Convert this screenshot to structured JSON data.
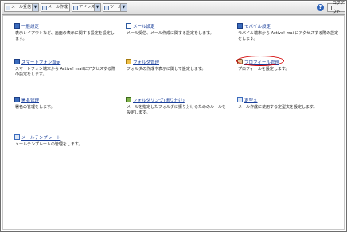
{
  "toolbar": {
    "buttons": [
      {
        "label": "メール受信",
        "icon": "mail-receive-icon"
      },
      {
        "label": "メール作成",
        "icon": "mail-compose-icon"
      },
      {
        "label": "アドレス帳",
        "icon": "address-book-icon"
      },
      {
        "label": "ツール",
        "icon": "tools-icon"
      }
    ],
    "help": "?",
    "logout": "ログアウト"
  },
  "items": [
    {
      "title": "一般設定",
      "desc": "表示レイアウトなど、画面の表示に関する設定を設定します。",
      "icon": "settings-icon"
    },
    {
      "title": "メール設定",
      "desc": "メール受信、メール作成に関する設定をします。",
      "icon": "mail-settings-icon"
    },
    {
      "title": "モバイル設定",
      "desc": "モバイル端末から Active! mailにアクセスする際の設定をします。",
      "icon": "mobile-icon"
    },
    {
      "title": "スマートフォン設定",
      "desc": "スマートフォン端末から Active! mailにアクセスする際の設定をします。",
      "icon": "smartphone-icon"
    },
    {
      "title": "フォルダ管理",
      "desc": "フォルダの作成や表示に関して設定します。",
      "icon": "folder-icon"
    },
    {
      "title": "プロフィール管理",
      "desc": "プロフィールを設定します。",
      "icon": "profile-icon"
    },
    {
      "title": "署名管理",
      "desc": "署名の管理をします。",
      "icon": "signature-icon"
    },
    {
      "title": "フォルダリング(振り分け)",
      "desc": "メールを指定したフォルダに振り分けるためのルールを設定します。",
      "icon": "filter-icon"
    },
    {
      "title": "定型文",
      "desc": "メール作成に使用する定型文を設定します。",
      "icon": "template-text-icon"
    },
    {
      "title": "メールテンプレート",
      "desc": "メールテンプレートの管理をします。",
      "icon": "mail-template-icon"
    }
  ]
}
